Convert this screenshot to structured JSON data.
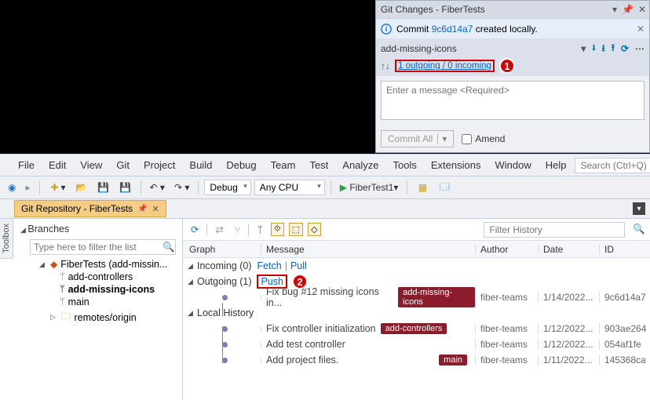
{
  "git_changes": {
    "title": "Git Changes - FiberTests",
    "info_prefix": "Commit ",
    "info_hash": "9c6d14a7",
    "info_suffix": " created locally.",
    "branch": "add-missing-icons",
    "sync_text": "1 outgoing / 0 incoming",
    "callout": "1",
    "message_placeholder": "Enter a message <Required>",
    "commit_button": "Commit All",
    "amend_label": "Amend"
  },
  "menu": {
    "items": [
      "File",
      "Edit",
      "View",
      "Git",
      "Project",
      "Build",
      "Debug",
      "Team",
      "Test",
      "Analyze",
      "Tools",
      "Extensions",
      "Window",
      "Help"
    ],
    "search_placeholder": "Search (Ctrl+Q)"
  },
  "toolbar": {
    "config": "Debug",
    "platform": "Any CPU",
    "start_target": "FiberTest1"
  },
  "tab": {
    "label": "Git Repository - FiberTests"
  },
  "side_tool": "Toolbox",
  "branches": {
    "header": "Branches",
    "filter_placeholder": "Type here to filter the list",
    "repo_label": "FiberTests (add-missin...",
    "items": [
      "add-controllers",
      "add-missing-icons",
      "main"
    ],
    "remotes": "remotes/origin"
  },
  "history": {
    "filter_placeholder": "Filter History",
    "columns": {
      "graph": "Graph",
      "message": "Message",
      "author": "Author",
      "date": "Date",
      "id": "ID"
    },
    "incoming_label": "Incoming (0)",
    "fetch": "Fetch",
    "pull": "Pull",
    "outgoing_label": "Outgoing (1)",
    "push": "Push",
    "push_callout": "2",
    "local_label": "Local History",
    "commits": [
      {
        "msg": "Fix bug #12 missing icons in...",
        "tag": "add-missing-icons",
        "author": "fiber-teams",
        "date": "1/14/2022...",
        "id": "9c6d14a7"
      },
      {
        "msg": "Fix controller initialization",
        "tag": "add-controllers",
        "author": "fiber-teams",
        "date": "1/12/2022...",
        "id": "903ae264"
      },
      {
        "msg": "Add test controller",
        "tag": "",
        "author": "fiber-teams",
        "date": "1/12/2022...",
        "id": "054af1fe"
      },
      {
        "msg": "Add project files.",
        "tag": "main",
        "author": "fiber-teams",
        "date": "1/11/2022...",
        "id": "145368ca"
      }
    ]
  }
}
